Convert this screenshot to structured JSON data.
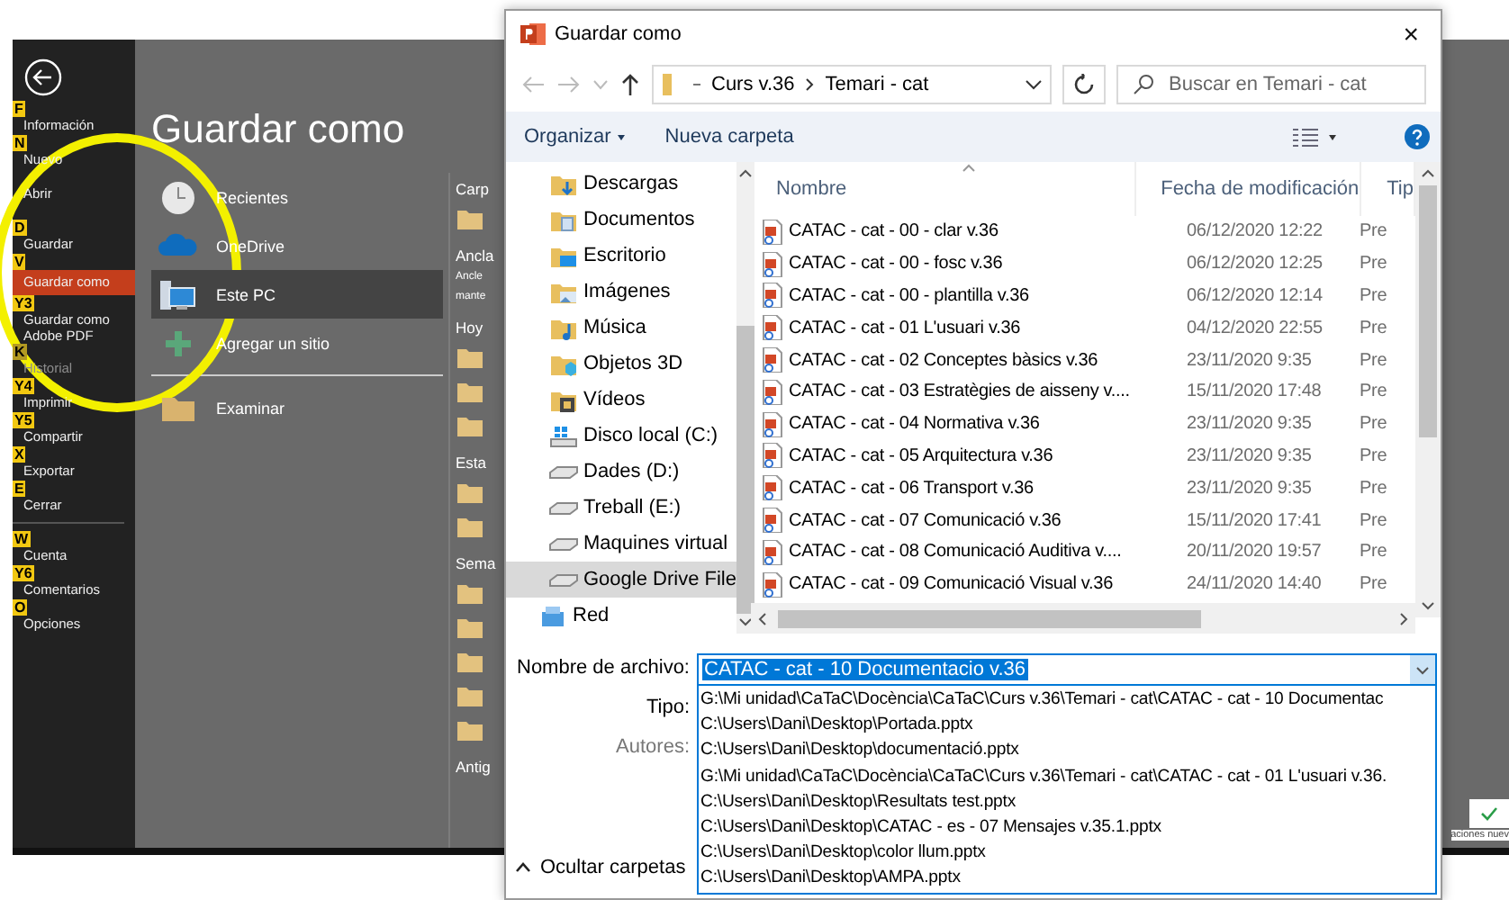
{
  "backstage": {
    "menu_groups": [
      {
        "items": [
          {
            "key": "F",
            "label": "Información",
            "selected": false,
            "disabled": false
          },
          {
            "key": "N",
            "label": "Nuevo",
            "selected": false,
            "disabled": false
          },
          {
            "label": "Abrir",
            "selected": false,
            "disabled": false
          },
          {
            "key": "D",
            "label": "Guardar",
            "selected": false,
            "disabled": false
          },
          {
            "key": "V",
            "label": "Guardar como",
            "selected": true,
            "disabled": false
          },
          {
            "key": "Y3",
            "label": "Guardar como Adobe PDF",
            "selected": false,
            "disabled": false
          },
          {
            "key": "K",
            "label": "Historial",
            "selected": false,
            "disabled": true
          },
          {
            "key": "Y4",
            "label": "Imprimir",
            "selected": false,
            "disabled": false
          },
          {
            "key": "Y5",
            "label": "Compartir",
            "selected": false,
            "disabled": false
          },
          {
            "key": "X",
            "label": "Exportar",
            "selected": false,
            "disabled": false
          },
          {
            "key": "E",
            "label": "Cerrar",
            "selected": false,
            "disabled": false
          }
        ]
      },
      {
        "items": [
          {
            "key": "W",
            "label": "Cuenta",
            "selected": false,
            "disabled": false
          },
          {
            "key": "Y6",
            "label": "Comentarios",
            "selected": false,
            "disabled": false
          },
          {
            "key": "O",
            "label": "Opciones",
            "selected": false,
            "disabled": false
          }
        ]
      }
    ],
    "title": "Guardar como",
    "places": [
      {
        "kind": "recent",
        "label": "Recientes",
        "selected": false,
        "divider_before": false
      },
      {
        "kind": "cloud",
        "label": "OneDrive",
        "selected": false,
        "divider_before": false
      },
      {
        "kind": "pc",
        "label": "Este PC",
        "selected": true,
        "divider_before": false
      },
      {
        "kind": "add",
        "label": "Agregar un sitio",
        "selected": false,
        "divider_before": false
      },
      {
        "kind": "browse",
        "label": "Examinar",
        "selected": false,
        "divider_before": true
      }
    ],
    "pinned": [
      {
        "kind": "heading",
        "label": "Carp"
      },
      {
        "kind": "folder"
      },
      {
        "kind": "heading",
        "label": "Ancla"
      },
      {
        "kind": "note",
        "label": "Ancle"
      },
      {
        "kind": "note",
        "label": "mante"
      },
      {
        "kind": "heading",
        "label": "Hoy"
      },
      {
        "kind": "folder"
      },
      {
        "kind": "folder"
      },
      {
        "kind": "folder"
      },
      {
        "kind": "heading",
        "label": "Esta"
      },
      {
        "kind": "folder"
      },
      {
        "kind": "folder"
      },
      {
        "kind": "heading",
        "label": "Sema"
      },
      {
        "kind": "folder"
      },
      {
        "kind": "folder"
      },
      {
        "kind": "folder"
      },
      {
        "kind": "folder"
      },
      {
        "kind": "folder"
      },
      {
        "kind": "heading",
        "label": "Antig"
      }
    ],
    "notification": "aciones nuev"
  },
  "dialog": {
    "title": "Guardar como",
    "close": "×",
    "breadcrumb": [
      "Curs v.36",
      "Temari - cat"
    ],
    "search": {
      "placeholder": "Buscar en Temari - cat"
    },
    "toolbar": {
      "organize": "Organizar",
      "new_folder": "Nueva carpeta"
    },
    "nav_items": [
      {
        "kind": "downloads",
        "label": "Descargas",
        "selected": false
      },
      {
        "kind": "documents",
        "label": "Documentos",
        "selected": false
      },
      {
        "kind": "desktop",
        "label": "Escritorio",
        "selected": false
      },
      {
        "kind": "pictures",
        "label": "Imágenes",
        "selected": false
      },
      {
        "kind": "music",
        "label": "Música",
        "selected": false
      },
      {
        "kind": "objects",
        "label": "Objetos 3D",
        "selected": false
      },
      {
        "kind": "videos",
        "label": "Vídeos",
        "selected": false
      },
      {
        "kind": "system_drive",
        "label": "Disco local (C:)",
        "selected": false
      },
      {
        "kind": "drive",
        "label": "Dades (D:)",
        "selected": false
      },
      {
        "kind": "drive",
        "label": "Treball (E:)",
        "selected": false
      },
      {
        "kind": "drive",
        "label": "Maquines virtual",
        "selected": false
      },
      {
        "kind": "drive",
        "label": "Google Drive File",
        "selected": true
      },
      {
        "kind": "network",
        "label": "Red",
        "selected": false
      }
    ],
    "columns": [
      "Nombre",
      "Fecha de modificación",
      "Tip"
    ],
    "files": [
      {
        "name": "CATAC - cat - 00 - clar v.36",
        "date": "06/12/2020 12:22",
        "type": "Pre"
      },
      {
        "name": "CATAC - cat - 00 - fosc v.36",
        "date": "06/12/2020 12:25",
        "type": "Pre"
      },
      {
        "name": "CATAC - cat - 00 - plantilla v.36",
        "date": "06/12/2020 12:14",
        "type": "Pre"
      },
      {
        "name": "CATAC - cat - 01 L'usuari v.36",
        "date": "04/12/2020 22:55",
        "type": "Pre"
      },
      {
        "name": "CATAC - cat - 02 Conceptes bàsics v.36",
        "date": "23/11/2020 9:35",
        "type": "Pre"
      },
      {
        "name": "CATAC - cat - 03 Estratègies de aisseny v....",
        "date": "15/11/2020 17:48",
        "type": "Pre"
      },
      {
        "name": "CATAC - cat - 04 Normativa v.36",
        "date": "23/11/2020 9:35",
        "type": "Pre"
      },
      {
        "name": "CATAC - cat - 05 Arquitectura v.36",
        "date": "23/11/2020 9:35",
        "type": "Pre"
      },
      {
        "name": "CATAC - cat - 06 Transport v.36",
        "date": "23/11/2020 9:35",
        "type": "Pre"
      },
      {
        "name": "CATAC - cat - 07 Comunicació v.36",
        "date": "15/11/2020 17:41",
        "type": "Pre"
      },
      {
        "name": "CATAC - cat - 08 Comunicació Auditiva v....",
        "date": "20/11/2020 19:57",
        "type": "Pre"
      },
      {
        "name": "CATAC - cat - 09 Comunicació Visual v.36",
        "date": "24/11/2020 14:40",
        "type": "Pre"
      }
    ],
    "filename": {
      "label": "Nombre de archivo:",
      "value": "CATAC - cat - 10 Documentacio v.36"
    },
    "type_label": "Tipo:",
    "authors_label": "Autores:",
    "history": [
      "G:\\Mi unidad\\CaTaC\\Docència\\CaTaC\\Curs v.36\\Temari - cat\\CATAC - cat - 10 Documentac",
      "C:\\Users\\Dani\\Desktop\\Portada.pptx",
      "C:\\Users\\Dani\\Desktop\\documentació.pptx",
      "G:\\Mi unidad\\CaTaC\\Docència\\CaTaC\\Curs v.36\\Temari - cat\\CATAC - cat - 01 L'usuari v.36.",
      "C:\\Users\\Dani\\Desktop\\Resultats test.pptx",
      "C:\\Users\\Dani\\Desktop\\CATAC - es - 07 Mensajes v.35.1.pptx",
      "C:\\Users\\Dani\\Desktop\\color llum.pptx",
      "C:\\Users\\Dani\\Desktop\\AMPA.pptx"
    ],
    "hide_folders": "Ocultar carpetas"
  }
}
